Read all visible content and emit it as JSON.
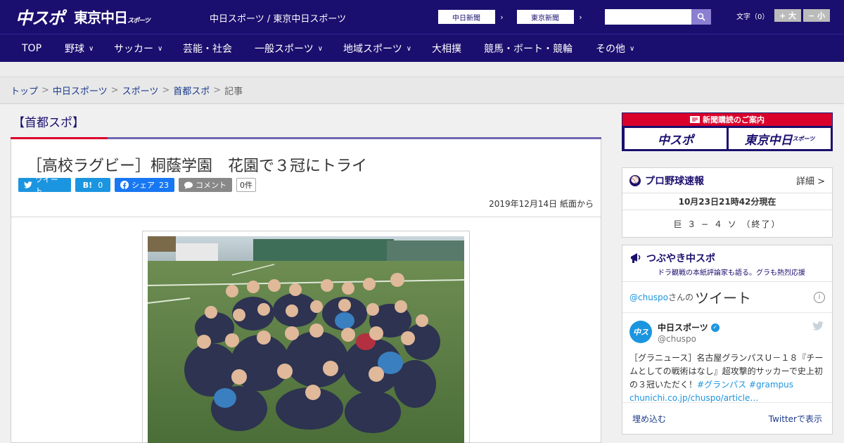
{
  "header": {
    "logo_main": "中スポ",
    "logo_tokyo": "東京中日",
    "logo_tokyo_small": "スポーツ",
    "site_names": "中日スポーツ / 東京中日スポーツ",
    "ext_links": [
      {
        "label": "中日新聞",
        "arrow": "›"
      },
      {
        "label": "東京新聞",
        "arrow": "›"
      }
    ],
    "search_placeholder": "",
    "font_size_label": "文字（0）",
    "font_bigger": "+ 大",
    "font_smaller": "− 小"
  },
  "nav": {
    "items": [
      {
        "label": "TOP",
        "chev": ""
      },
      {
        "label": "野球",
        "chev": "∨"
      },
      {
        "label": "サッカー",
        "chev": "∨"
      },
      {
        "label": "芸能・社会",
        "chev": ""
      },
      {
        "label": "一般スポーツ",
        "chev": "∨"
      },
      {
        "label": "地域スポーツ",
        "chev": "∨"
      },
      {
        "label": "大相撲",
        "chev": ""
      },
      {
        "label": "競馬・ボート・競輪",
        "chev": ""
      },
      {
        "label": "その他",
        "chev": "∨"
      }
    ]
  },
  "breadcrumb": {
    "items": [
      "トップ",
      "中日スポーツ",
      "スポーツ",
      "首都スポ"
    ],
    "current": "記事",
    "sep": ">"
  },
  "article": {
    "section": "【首都スポ】",
    "title": "［高校ラグビー］桐蔭学園　花園で３冠にトライ",
    "share": {
      "tweet": "ツイート",
      "hatena": "B!",
      "hatena_count": "0",
      "facebook": "シェア",
      "facebook_count": "23",
      "comment": "コメント",
      "comment_count": "0件"
    },
    "date": "2019年12月14日 紙面から"
  },
  "sidebar": {
    "subscribe": {
      "head": "新聞購読のご案内",
      "logo1": "中スポ",
      "logo2": "東京中日",
      "logo2_small": "スポーツ"
    },
    "baseball": {
      "title": "プロ野球速報",
      "more": "詳細 >",
      "time": "10月23日21時42分現在",
      "score": "巨 ３ − ４ ソ （終了）"
    },
    "twitter": {
      "title": "つぶやき中スポ",
      "sub": "ドラ観戦の本紙評論家も語る。グラも熱烈応援",
      "handle": "@chuspo",
      "handle_suffix": "さんの",
      "widget_title": "ツイート",
      "tweet_name": "中日スポーツ",
      "tweet_handle": "@chuspo",
      "tweet_text": "［グラニュース］名古屋グランパスＵ－１８『チームとしての戦術はなし』超攻撃的サッカーで史上初の３冠いただく！",
      "tweet_tag1": "#グランパス",
      "tweet_tag2": "#grampus",
      "tweet_link": "chunichi.co.jp/chuspo/article…",
      "embed": "埋め込む",
      "view_on": "Twitterで表示"
    }
  },
  "colors": {
    "brand_navy": "#1a0f6e",
    "accent_red": "#d9002b",
    "twitter_blue": "#1b95e0",
    "facebook_blue": "#1877f2"
  }
}
